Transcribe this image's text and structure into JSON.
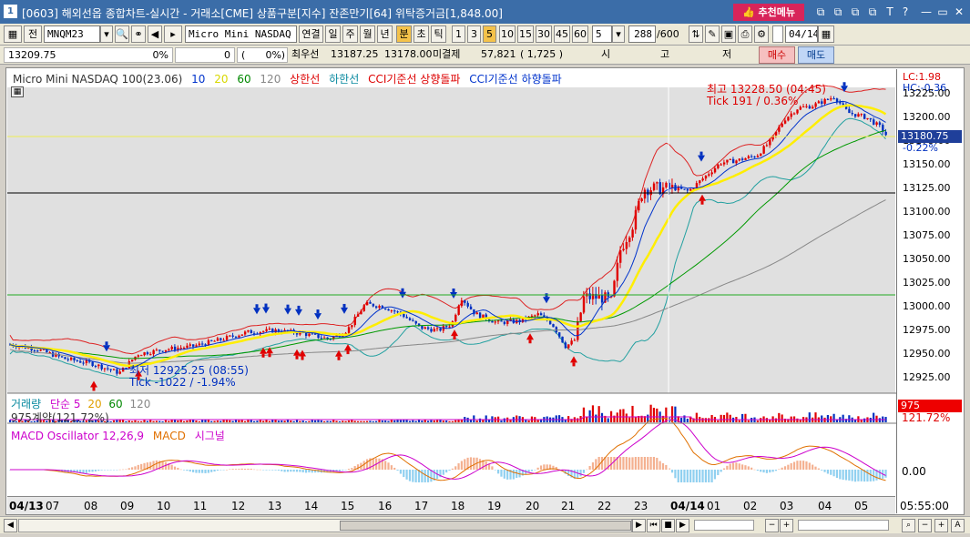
{
  "window": {
    "icon_label": "1",
    "title": "[0603] 해외선옵 종합차트-실시간 - 거래소[CME] 상품구분[지수] 잔존만기[64] 위탁증거금[1,848.00]",
    "recommend_label": "추천메뉴",
    "controls": [
      "⧉",
      "⧉",
      "⧉",
      "⧉",
      "T",
      "?",
      "—",
      "▭",
      "✕"
    ]
  },
  "toolbar": {
    "all_label": "전",
    "symbol_code": "MNQM23",
    "symbol_name": "Micro Mini NASDAQ 10",
    "continuous_label": "연결",
    "period_tabs": [
      "일",
      "주",
      "월",
      "년",
      "분",
      "초",
      "틱"
    ],
    "active_period": "분",
    "interval_options": [
      "1",
      "3",
      "5",
      "10",
      "15",
      "30",
      "45",
      "60"
    ],
    "active_interval": "5",
    "interval_value": "5",
    "count_display": "288",
    "count_total": "/600",
    "date_value": "04/14"
  },
  "quote": {
    "last_price": "13209.75",
    "change_pct": "0%",
    "change": "0",
    "change_pct2": "0%",
    "best_bid_label": "최우선",
    "best_bid": "13187.25",
    "best_ask": "13178.00",
    "open_interest_label": "미결제",
    "open_interest": "57,821",
    "oi_change": "1,725",
    "open_label": "시",
    "high_label": "고",
    "low_label": "저",
    "buy_label": "매수",
    "sell_label": "매도"
  },
  "legend": {
    "symbol": "Micro Mini NASDAQ 100(23.06)",
    "ma_periods": [
      "10",
      "20",
      "60",
      "120"
    ],
    "ma_colors": [
      "#0033cc",
      "#e6e600",
      "#008800",
      "#888888"
    ],
    "upper_band": "상한선",
    "lower_band": "하한선",
    "cci_up": "CCI기준선 상향돌파",
    "cci_down": "CCI기준선 하향돌파"
  },
  "annotations": {
    "high_label": "최고 13228.50 (04:45)",
    "high_tick": "Tick 191 / 0.36%",
    "low_label": "최저 12925.25 (08:55)",
    "low_tick": "Tick -1022 / -1.94%"
  },
  "price_axis": {
    "lc_label": "LC:1.98",
    "hc_label": "HC:-0.36",
    "current_price": "13180.75",
    "current_change": "-0.22%",
    "ticks": [
      "13225.00",
      "13200.00",
      "13175.00",
      "13150.00",
      "13125.00",
      "13100.00",
      "13075.00",
      "13050.00",
      "13025.00",
      "13000.00",
      "12975.00",
      "12950.00",
      "12925.00"
    ]
  },
  "volume": {
    "title": "거래량",
    "ma_label": "단순 5",
    "ma_periods": [
      "20",
      "60",
      "120"
    ],
    "summary": "975계약(121.72%)",
    "last_volume": "975",
    "last_ratio": "121.72%"
  },
  "macd": {
    "title": "MACD Oscillator 12,26,9",
    "macd_label": "MACD",
    "signal_label": "시그널",
    "zero_label": "0.00"
  },
  "x_axis": {
    "labels": [
      "04/13",
      "07",
      "08",
      "09",
      "10",
      "11",
      "12",
      "13",
      "14",
      "15",
      "16",
      "17",
      "18",
      "19",
      "20",
      "21",
      "22",
      "23",
      "04/14",
      "01",
      "02",
      "03",
      "04",
      "05"
    ],
    "time_label": "05:55:00"
  },
  "colors": {
    "up": "#e00000",
    "down": "#0030c0",
    "ma10": "#0033cc",
    "ma20": "#ffee00",
    "ma60": "#009900",
    "ma120": "#888888",
    "band": "#dd2222",
    "lower_band": "#22a0a0"
  }
}
